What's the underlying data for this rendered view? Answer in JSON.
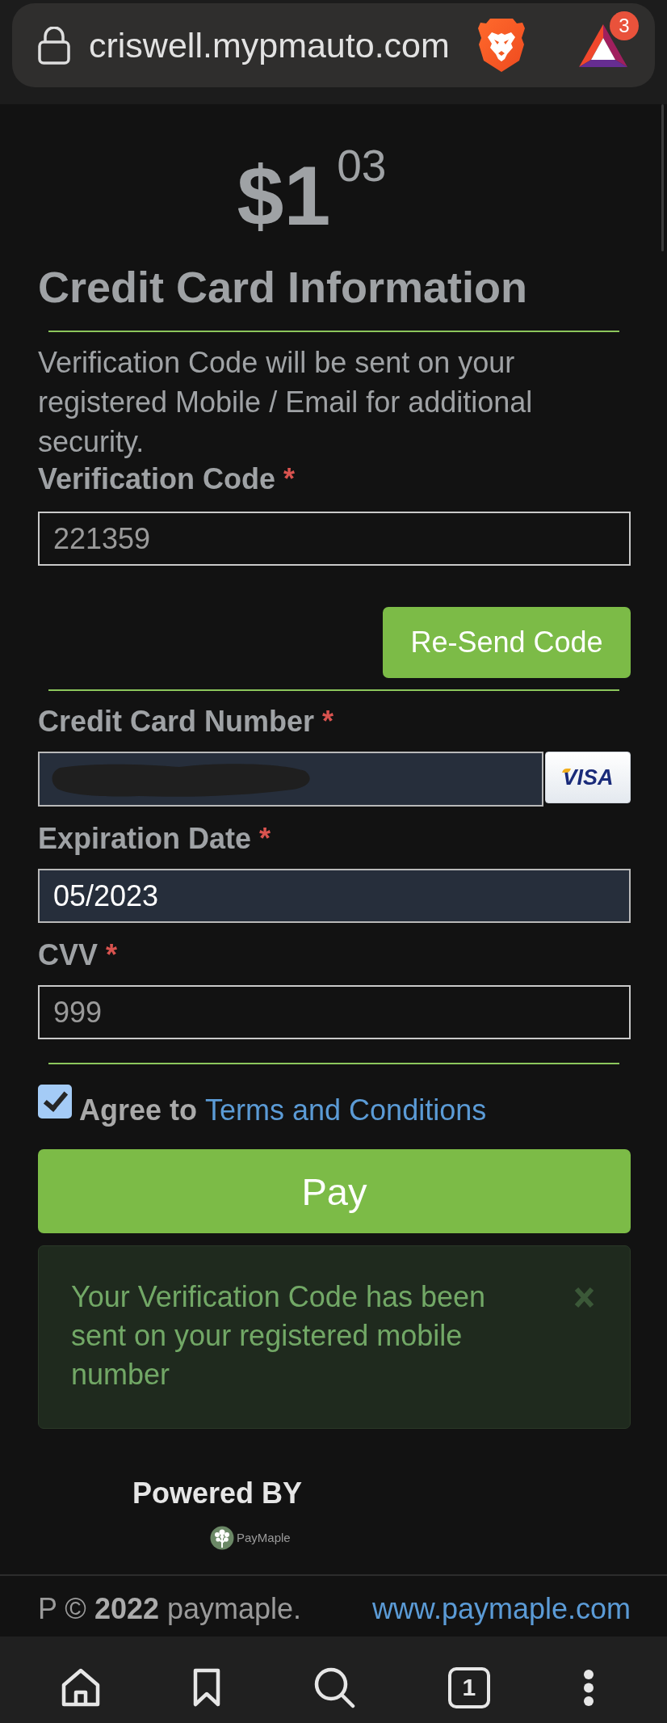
{
  "browser_bar": {
    "url": "criswell.mypmauto.com",
    "rewards_badge": "3"
  },
  "payment": {
    "amount": "$1",
    "cents": "03",
    "title": "Credit Card Information",
    "notice": "Verification Code will be sent on your registered Mobile / Email for additional security."
  },
  "verification": {
    "kind": "text",
    "label": "Verification Code",
    "required_mark": "*",
    "value": "221359",
    "autofilled": false,
    "resend_button": "Re-Send Code"
  },
  "card_fields": [
    {
      "kind": "card_number",
      "label": "Credit Card Number",
      "required_mark": "*",
      "autofilled": true,
      "redacted": true,
      "card_brand": "VISA"
    },
    {
      "kind": "text",
      "label": "Expiration Date",
      "required_mark": "*",
      "value": "05/2023",
      "autofilled": true
    },
    {
      "kind": "text",
      "label": "CVV",
      "required_mark": "*",
      "value": "999",
      "autofilled": false
    }
  ],
  "agreement": {
    "checked": true,
    "label": "Agree to",
    "link": "Terms and Conditions"
  },
  "pay_button": "Pay",
  "alert": {
    "message": "Your Verification Code has been sent on your registered mobile number"
  },
  "powered_by": {
    "label": "Powered BY",
    "logo_text": "PayMaple"
  },
  "footer": {
    "copyright": "P © **2022** paymaple.",
    "link": "www.paymaple.com"
  },
  "nav_bar": {
    "tab_count": "1"
  }
}
